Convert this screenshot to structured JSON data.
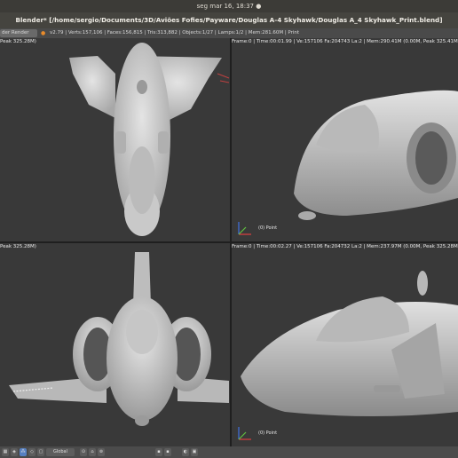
{
  "system": {
    "clock": "seg mar 16, 18:37 ●"
  },
  "window": {
    "title": "Blender* [/home/sergio/Documents/3D/Aviões Fofies/Payware/Douglas A-4 Skyhawk/Douglas A_4 Skyhawk_Print.blend]"
  },
  "info": {
    "render_engine": "der Render",
    "stats": "v2.79 | Verts:157,106 | Faces:156,815 | Tris:313,882 | Objects:1/27 | Lamps:1/2 | Mem:281.60M | Print"
  },
  "viewports": {
    "top_left": {
      "header": "Peak 325.28M)"
    },
    "top_right": {
      "header": "Frame:0 | Time:00:01.99 | Ve:157106 Fa:204743 La:2 | Mem:290.41M (0.00M, Peak 325.41M)",
      "object_label": "(0) Point"
    },
    "bottom_left": {
      "header": "Peak 325.28M)"
    },
    "bottom_right": {
      "header": "Frame:0 | Time:00:02.27 | Ve:157106 Fa:204732 La:2 | Mem:237.97M (0.00M, Peak 325.28M)",
      "object_label": "(0) Point"
    }
  },
  "toolbar": {
    "orientation": "Global"
  },
  "colors": {
    "viewport_bg": "#393939",
    "model": "#c8c8c8",
    "x_axis": "#e04040",
    "y_axis": "#60c040",
    "z_axis": "#4070e0"
  }
}
